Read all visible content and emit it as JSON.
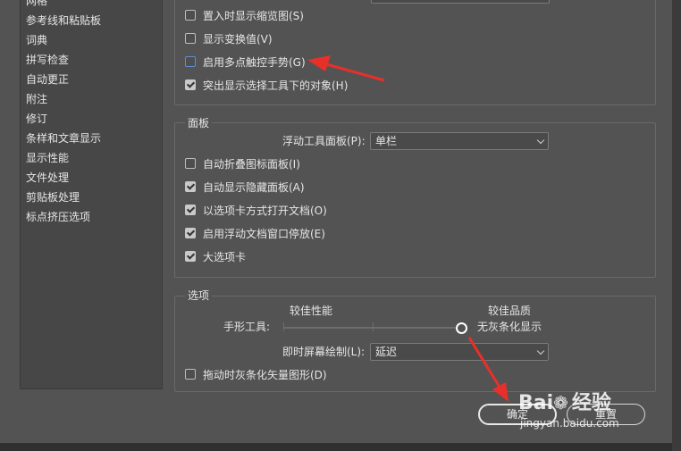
{
  "sidebar": {
    "items": [
      {
        "label": "网格"
      },
      {
        "label": "参考线和粘贴板"
      },
      {
        "label": "词典"
      },
      {
        "label": "拼写检查"
      },
      {
        "label": "自动更正"
      },
      {
        "label": "附注"
      },
      {
        "label": "修订"
      },
      {
        "label": "条样和文章显示"
      },
      {
        "label": "显示性能"
      },
      {
        "label": "文件处理"
      },
      {
        "label": "剪贴板处理"
      },
      {
        "label": "标点挤压选项"
      }
    ]
  },
  "top_group": {
    "options": [
      {
        "label": "置入时显示缩览图(S)",
        "checked": false
      },
      {
        "label": "显示变换值(V)",
        "checked": false
      },
      {
        "label": "启用多点触控手势(G)",
        "checked": false
      },
      {
        "label": "突出显示选择工具下的对象(H)",
        "checked": true
      }
    ]
  },
  "panels_group": {
    "title": "面板",
    "float_label": "浮动工具面板(P):",
    "float_value": "单栏",
    "options": [
      {
        "label": "自动折叠图标面板(I)",
        "checked": false
      },
      {
        "label": "自动显示隐藏面板(A)",
        "checked": true
      },
      {
        "label": "以选项卡方式打开文档(O)",
        "checked": true
      },
      {
        "label": "启用浮动文档窗口停放(E)",
        "checked": true
      },
      {
        "label": "大选项卡",
        "checked": true
      }
    ]
  },
  "options_group": {
    "title": "选项",
    "perf_label": "较佳性能",
    "quality_label": "较佳品质",
    "hand_tool_label": "手形工具:",
    "slider_value_label": "无灰条化显示",
    "slider_level": 1.0,
    "live_draw_label": "即时屏幕绘制(L):",
    "live_draw_value": "延迟",
    "greek_option": {
      "label": "拖动时灰条化矢量图形(D)",
      "checked": false
    }
  },
  "buttons": {
    "ok": "确定",
    "reset": "重置"
  },
  "watermark": {
    "brand": "Bai",
    "brand2": "经验",
    "url": "jingyan.baidu.com"
  },
  "colors": {
    "background": "#535353",
    "arrow": "#e8302a",
    "checkbox_focus": "#5b8fd6"
  }
}
